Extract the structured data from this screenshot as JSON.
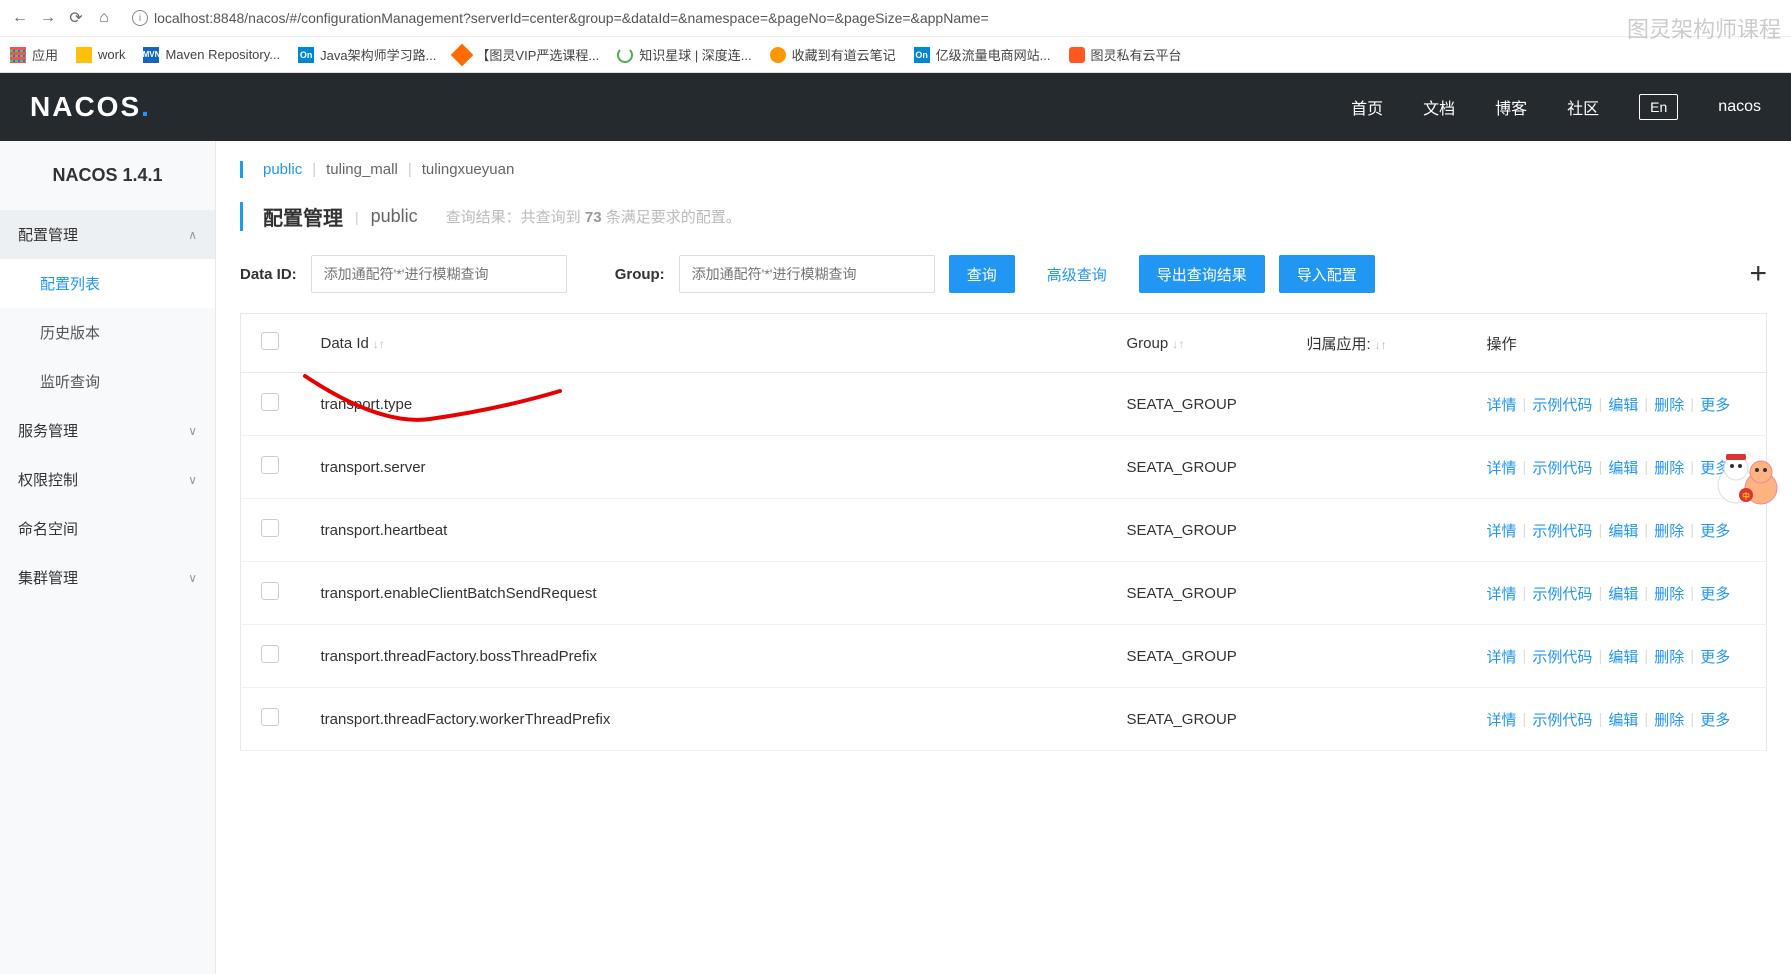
{
  "browser": {
    "url": "localhost:8848/nacos/#/configurationManagement?serverId=center&group=&dataId=&namespace=&pageNo=&pageSize=&appName=",
    "bookmarks": {
      "apps": "应用",
      "work": "work",
      "maven": "Maven Repository...",
      "java": "Java架构师学习路...",
      "tuling_vip": "【图灵VIP严选课程...",
      "zhishi": "知识星球 | 深度连...",
      "youdao": "收藏到有道云笔记",
      "mall": "亿级流量电商网站...",
      "private": "图灵私有云平台"
    }
  },
  "header": {
    "logo": "NACOS",
    "nav": {
      "home": "首页",
      "docs": "文档",
      "blog": "博客",
      "community": "社区",
      "lang": "En",
      "user": "nacos"
    }
  },
  "sidebar": {
    "version": "NACOS 1.4.1",
    "config_mgmt": "配置管理",
    "config_list": "配置列表",
    "history": "历史版本",
    "listen": "监听查询",
    "service_mgmt": "服务管理",
    "auth": "权限控制",
    "namespace": "命名空间",
    "cluster": "集群管理"
  },
  "namespaces": {
    "public": "public",
    "tuling_mall": "tuling_mall",
    "tulingxueyuan": "tulingxueyuan"
  },
  "page": {
    "title": "配置管理",
    "scope": "public",
    "result_prefix": "查询结果：共查询到",
    "result_count": "73",
    "result_suffix": "条满足要求的配置。"
  },
  "filters": {
    "dataid_label": "Data ID:",
    "dataid_placeholder": "添加通配符'*'进行模糊查询",
    "group_label": "Group:",
    "group_placeholder": "添加通配符'*'进行模糊查询",
    "query_btn": "查询",
    "adv_query": "高级查询",
    "export_btn": "导出查询结果",
    "import_btn": "导入配置"
  },
  "table": {
    "headers": {
      "dataid": "Data Id",
      "group": "Group",
      "app": "归属应用:",
      "ops": "操作"
    },
    "actions": {
      "detail": "详情",
      "sample": "示例代码",
      "edit": "编辑",
      "delete": "删除",
      "more": "更多"
    },
    "rows": [
      {
        "dataId": "transport.type",
        "group": "SEATA_GROUP",
        "app": ""
      },
      {
        "dataId": "transport.server",
        "group": "SEATA_GROUP",
        "app": ""
      },
      {
        "dataId": "transport.heartbeat",
        "group": "SEATA_GROUP",
        "app": ""
      },
      {
        "dataId": "transport.enableClientBatchSendRequest",
        "group": "SEATA_GROUP",
        "app": ""
      },
      {
        "dataId": "transport.threadFactory.bossThreadPrefix",
        "group": "SEATA_GROUP",
        "app": ""
      },
      {
        "dataId": "transport.threadFactory.workerThreadPrefix",
        "group": "SEATA_GROUP",
        "app": ""
      }
    ]
  },
  "watermark": "图灵架构师课程"
}
